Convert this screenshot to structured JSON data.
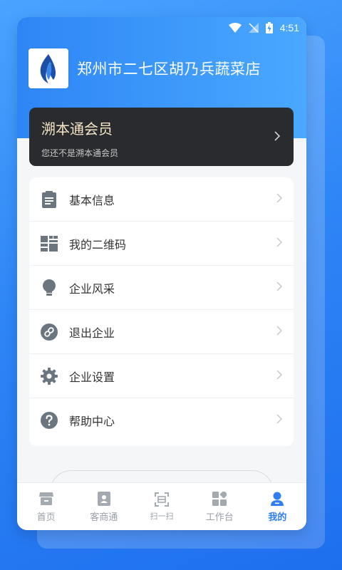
{
  "status_bar": {
    "time": "4:51"
  },
  "shop": {
    "name": "郑州市二七区胡乃兵蔬菜店",
    "logo_icon": "flame-logo-icon"
  },
  "member": {
    "title": "溯本通会员",
    "subtitle": "您还不是溯本通会员"
  },
  "menu": {
    "items": [
      {
        "label": "基本信息",
        "icon": "clipboard-icon"
      },
      {
        "label": "我的二维码",
        "icon": "qrcode-icon"
      },
      {
        "label": "企业风采",
        "icon": "lightbulb-icon"
      },
      {
        "label": "退出企业",
        "icon": "unlink-icon"
      },
      {
        "label": "企业设置",
        "icon": "gear-icon"
      },
      {
        "label": "帮助中心",
        "icon": "help-icon"
      }
    ]
  },
  "tabbar": {
    "tabs": [
      {
        "label": "首页",
        "icon": "store-icon"
      },
      {
        "label": "客商通",
        "icon": "contact-card-icon"
      },
      {
        "label": "扫一扫",
        "icon": "scan-icon"
      },
      {
        "label": "工作台",
        "icon": "grid-icon"
      },
      {
        "label": "我的",
        "icon": "person-icon",
        "active": true
      }
    ]
  },
  "colors": {
    "accent": "#2f7ff2",
    "header": "#2e86f5",
    "member_card": "#2a2b2e",
    "icon_gray": "#6b7580"
  }
}
